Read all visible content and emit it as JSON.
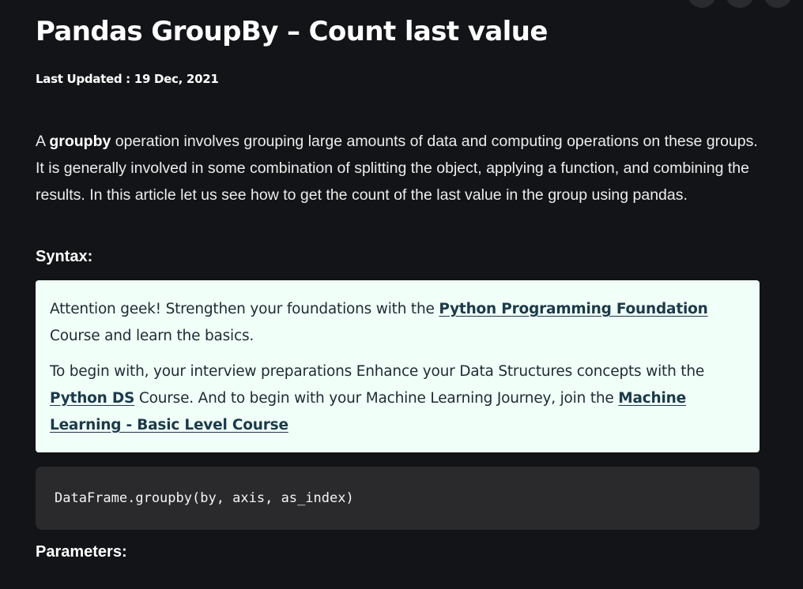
{
  "article": {
    "title": "Pandas GroupBy – Count last value",
    "last_updated": "Last Updated : 19 Dec, 2021",
    "intro": {
      "prefix": "A ",
      "bold": "groupby",
      "rest": " operation involves grouping large amounts of data and computing operations on these groups. It is generally involved in some combination of splitting the object, applying a function, and combining the results. In this article let us see how to get the count of the last value in the group using pandas."
    },
    "syntax_label": "Syntax:",
    "params_label": "Parameters:"
  },
  "promo": {
    "line1_prefix": " Attention geek! Strengthen your foundations with the ",
    "link1": "Python Programming Foundation",
    "line1_suffix": " Course and learn the basics.",
    "line2_prefix": "To begin with, your interview preparations Enhance your Data Structures concepts with the ",
    "link2": "Python DS",
    "line2_mid": " Course. And to begin with your Machine Learning Journey, join the ",
    "link3": "Machine Learning - Basic Level Course"
  },
  "code": {
    "syntax_line": "DataFrame.groupby(by, axis, as_index)"
  }
}
